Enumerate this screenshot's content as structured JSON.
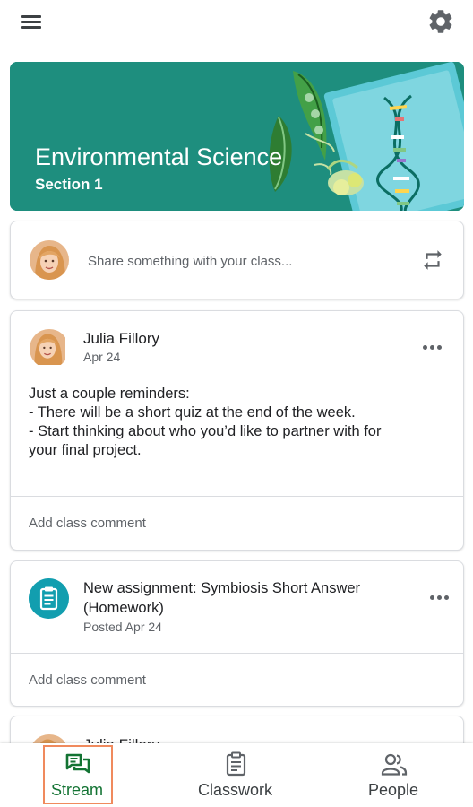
{
  "topbar": {
    "menu_icon": "hamburger-menu-icon",
    "settings_icon": "gear-icon"
  },
  "banner": {
    "title": "Environmental Science",
    "section": "Section 1",
    "color": "#1e8e7e"
  },
  "share": {
    "placeholder": "Share something with your class...",
    "repost_icon": "repost-icon"
  },
  "post": {
    "author": "Julia Fillory",
    "date": "Apr 24",
    "body_lines": [
      "Just a couple reminders:",
      "- There will be a short quiz at the end of the week.",
      "- Start thinking about who you’d like to partner with for",
      "your final project."
    ],
    "comment_label": "Add class comment"
  },
  "assignment": {
    "title": "New assignment: Symbiosis Short Answer (Homework)",
    "date": "Posted Apr 24",
    "comment_label": "Add class comment",
    "icon_color": "#129eaf"
  },
  "partial_post": {
    "author": "Julia Fillory"
  },
  "bottom_nav": {
    "active_color": "#137333",
    "items": [
      {
        "label": "Stream",
        "icon": "stream-icon",
        "active": true
      },
      {
        "label": "Classwork",
        "icon": "classwork-icon",
        "active": false
      },
      {
        "label": "People",
        "icon": "people-icon",
        "active": false
      }
    ]
  }
}
